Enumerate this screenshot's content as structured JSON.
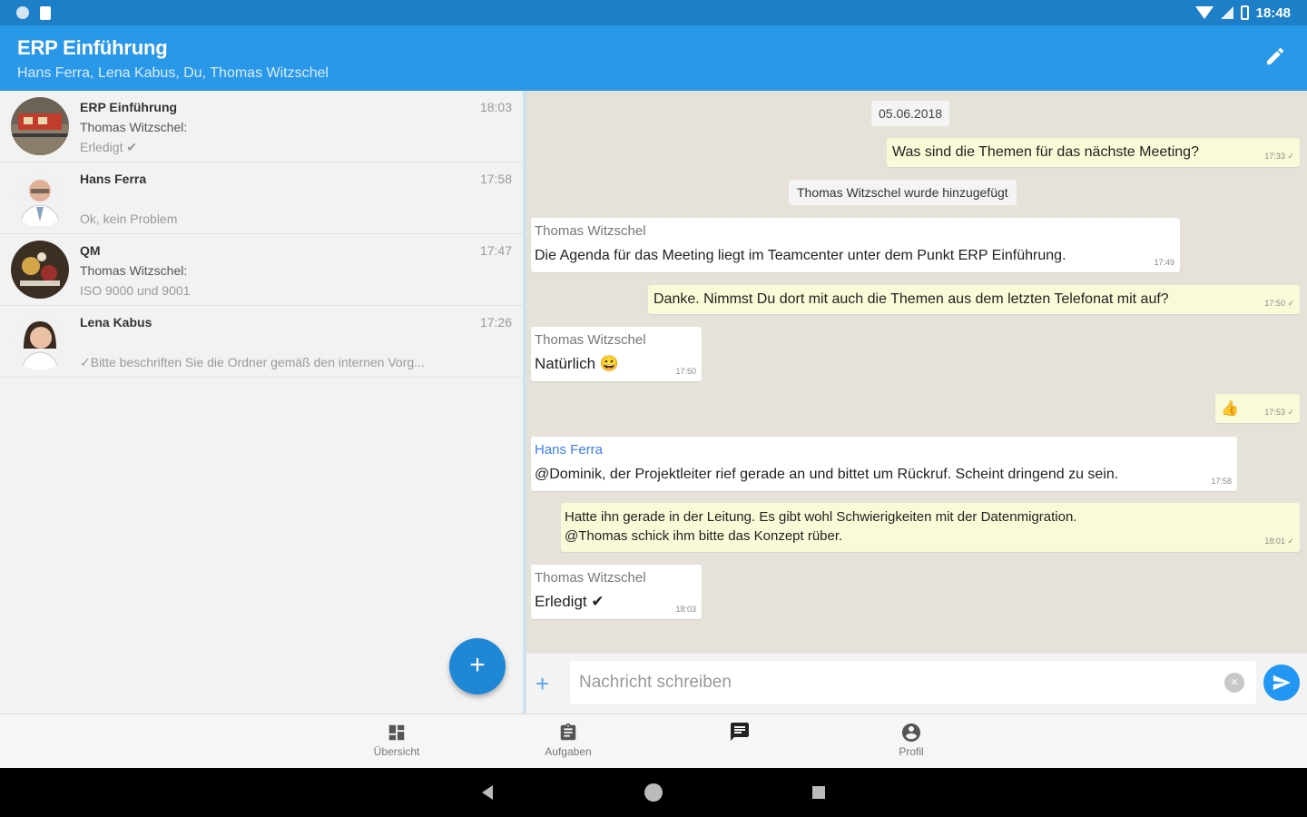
{
  "status_bar": {
    "time": "18:48"
  },
  "header": {
    "title": "ERP Einführung",
    "subtitle": "Hans Ferra, Lena Kabus, Du, Thomas Witzschel",
    "edit_icon": "pencil-icon"
  },
  "chat_list": [
    {
      "name": "ERP Einführung",
      "line1": "Thomas Witzschel:",
      "line2": "Erledigt ✔",
      "time": "18:03"
    },
    {
      "name": "Hans Ferra",
      "line1": "",
      "line2": "Ok, kein Problem",
      "time": "17:58"
    },
    {
      "name": "QM",
      "line1": "Thomas Witzschel:",
      "line2": "ISO 9000 und 9001",
      "time": "17:47"
    },
    {
      "name": "Lena Kabus",
      "line1": "",
      "line2": "✓Bitte beschriften Sie die Ordner gemäß den internen Vorg...",
      "time": "17:26"
    }
  ],
  "messages": {
    "date": "05.06.2018",
    "m1": {
      "text": "Was sind die Themen für das nächste Meeting?",
      "time": "17:33 ✓"
    },
    "system": "Thomas Witzschel wurde hinzugefügt",
    "m2": {
      "sender": "Thomas Witzschel",
      "text": "Die Agenda für das Meeting liegt im Teamcenter unter dem Punkt ERP Einführung.",
      "time": "17:49"
    },
    "m3": {
      "text": "Danke. Nimmst Du dort mit auch die Themen aus dem letzten Telefonat mit auf?",
      "time": "17:50 ✓"
    },
    "m4": {
      "sender": "Thomas Witzschel",
      "text": "Natürlich 😀",
      "time": "17:50"
    },
    "m5": {
      "text": "👍",
      "time": "17:53 ✓"
    },
    "m6": {
      "sender": "Hans Ferra",
      "text": "@Dominik, der Projektleiter rief gerade an und bittet um Rückruf. Scheint dringend zu sein.",
      "time": "17:58"
    },
    "m7": {
      "text1": "Hatte ihn gerade in der Leitung. Es gibt wohl Schwierigkeiten mit der Datenmigration.",
      "text2": "@Thomas schick ihm bitte das Konzept rüber.",
      "time": "18:01 ✓"
    },
    "m8": {
      "sender": "Thomas Witzschel",
      "text": "Erledigt ✔",
      "time": "18:03"
    }
  },
  "composer": {
    "placeholder": "Nachricht schreiben"
  },
  "bottom_nav": [
    {
      "label": "Übersicht",
      "icon": "dashboard-icon"
    },
    {
      "label": "Aufgaben",
      "icon": "clipboard-icon"
    },
    {
      "label": "",
      "icon": "chat-icon"
    },
    {
      "label": "Profil",
      "icon": "profile-icon"
    }
  ],
  "colors": {
    "primary": "#2a98e8",
    "status_bar": "#1e7fc9",
    "accent": "#1e88d6",
    "outgoing": "#fafad8",
    "chat_bg": "#e6e2da"
  }
}
